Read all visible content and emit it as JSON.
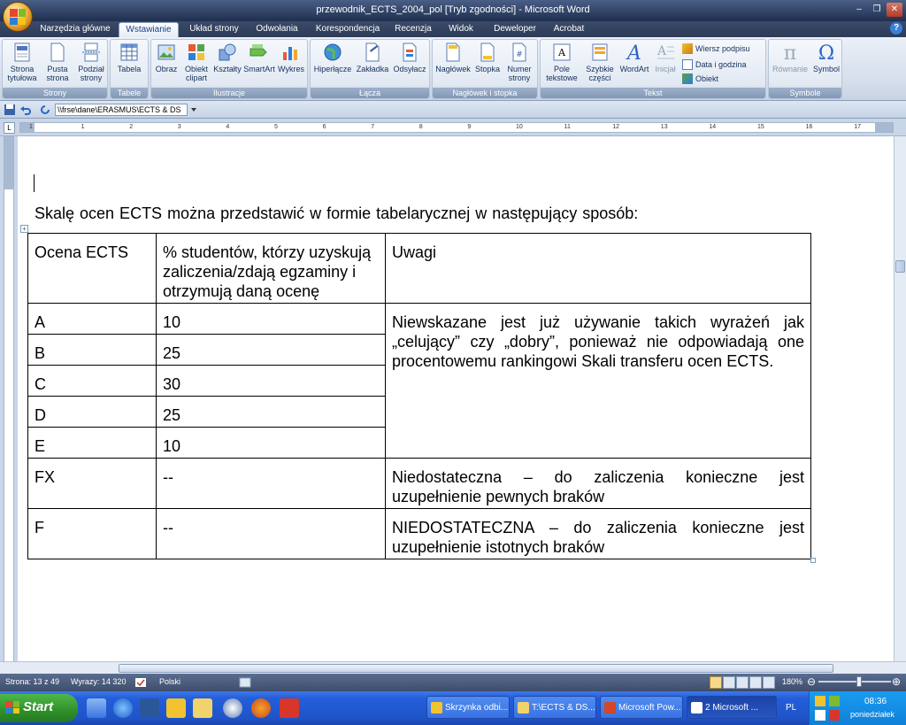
{
  "window": {
    "title": "przewodnik_ECTS_2004_pol [Tryb zgodności] - Microsoft Word"
  },
  "ribbon_tabs": [
    "Narzędzia główne",
    "Wstawianie",
    "Układ strony",
    "Odwołania",
    "Korespondencja",
    "Recenzja",
    "Widok",
    "Deweloper",
    "Acrobat"
  ],
  "active_tab": "Wstawianie",
  "groups": {
    "strony": {
      "label": "Strony",
      "buttons": [
        "Strona tytułowa",
        "Pusta strona",
        "Podział strony"
      ]
    },
    "tabele": {
      "label": "Tabele",
      "buttons": [
        "Tabela"
      ]
    },
    "ilustracje": {
      "label": "Ilustracje",
      "buttons": [
        "Obraz",
        "Obiekt clipart",
        "Kształty",
        "SmartArt",
        "Wykres"
      ]
    },
    "lacza": {
      "label": "Łącza",
      "buttons": [
        "Hiperłącze",
        "Zakładka",
        "Odsyłacz"
      ]
    },
    "naglowek": {
      "label": "Nagłówek i stopka",
      "buttons": [
        "Nagłówek",
        "Stopka",
        "Numer strony"
      ]
    },
    "tekst": {
      "label": "Tekst",
      "buttons": [
        "Pole tekstowe",
        "Szybkie części",
        "WordArt",
        "Inicjał"
      ],
      "small": [
        "Wiersz podpisu",
        "Data i godzina",
        "Obiekt"
      ]
    },
    "symbole": {
      "label": "Symbole",
      "buttons": [
        "Równanie",
        "Symbol"
      ]
    }
  },
  "address": "\\\\frse\\dane\\ERASMUS\\ECTS & DS",
  "ruler_numbers": [
    "1",
    "2",
    "1",
    "2",
    "3",
    "4",
    "5",
    "6",
    "7",
    "8",
    "9",
    "10",
    "11",
    "12",
    "13",
    "14",
    "15",
    "16",
    "17"
  ],
  "document": {
    "intro": "Skalę ocen ECTS można przedstawić w formie tabelarycznej w następujący sposób:",
    "headers": [
      "Ocena ECTS",
      "% studentów, którzy uzyskują zaliczenia/zdają egzaminy i otrzymują daną ocenę",
      "Uwagi"
    ],
    "grades": [
      {
        "grade": "A",
        "percent": "10"
      },
      {
        "grade": "B",
        "percent": "25"
      },
      {
        "grade": "C",
        "percent": "30"
      },
      {
        "grade": "D",
        "percent": "25"
      },
      {
        "grade": "E",
        "percent": "10"
      }
    ],
    "grades_note": "Niewskazane jest już używanie takich wyrażeń jak „celujący” czy „dobry”, ponieważ nie odpowiadają one procentowemu rankingowi Skali transferu ocen ECTS.",
    "fail_rows": [
      {
        "grade": "FX",
        "percent": "--",
        "note": "Niedostateczna – do zaliczenia konieczne jest uzupełnienie pewnych braków"
      },
      {
        "grade": "F",
        "percent": "--",
        "note": "NIEDOSTATECZNA – do zaliczenia konieczne jest uzupełnienie istotnych braków"
      }
    ]
  },
  "status": {
    "page": "Strona: 13 z 49",
    "words": "Wyrazy: 14 320",
    "language": "Polski",
    "zoom": "180%"
  },
  "taskbar": {
    "start": "Start",
    "tasks": [
      "Skrzynka odbi...",
      "T:\\ECTS & DS...",
      "Microsoft Pow...",
      "2 Microsoft ..."
    ],
    "lang": "PL",
    "time": "08:36",
    "day": "poniedziałek"
  }
}
